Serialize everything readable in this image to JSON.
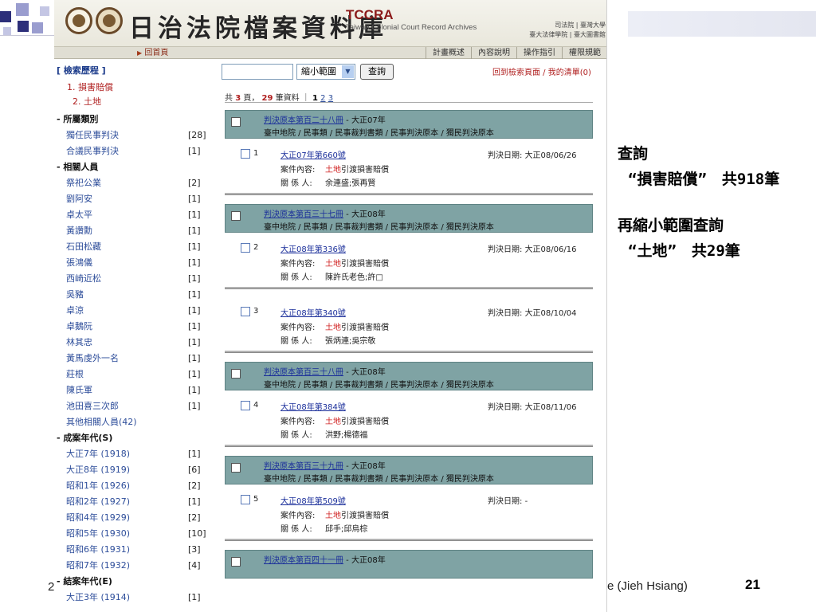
{
  "slide": {
    "annotation_lines": [
      "查詢",
      "“損害賠償”　共918筆",
      "再縮小範圍查詢",
      "“土地”　共29筆"
    ],
    "footer_left": "2",
    "footer_author": "e (Jieh Hsiang)",
    "page_number": "21",
    "colors": {
      "deco_dark": "#2d2f7a",
      "deco_light": "#9a9dcf",
      "panel": "#7fa3a4"
    }
  },
  "browser": {
    "banner": {
      "title": "日治法院檔案資料庫",
      "logo_text": "TCCRA",
      "subtitle": "Taiwan Colonial Court Record Archives",
      "sponsors_line1": "司法院 | 臺灣大學",
      "sponsors_line2": "臺大法律學院 | 臺大圖書館"
    },
    "nav": {
      "home": "回首頁",
      "tabs": [
        "計畫概述",
        "內容說明",
        "操作指引",
        "權限規範"
      ]
    },
    "sidebar": {
      "history_title": "[ 檢索歷程 ]",
      "history": [
        "1. 損害賠償",
        "2. 土地"
      ],
      "rows": [
        {
          "label": "- 所屬類別",
          "count": "",
          "cat": true
        },
        {
          "label": "獨任民事判決",
          "count": "[28]"
        },
        {
          "label": "合議民事判決",
          "count": "[1]"
        },
        {
          "label": "- 相關人員",
          "count": "",
          "cat": true
        },
        {
          "label": "祭祀公業",
          "count": "[2]"
        },
        {
          "label": "劉阿安",
          "count": "[1]"
        },
        {
          "label": "卓太平",
          "count": "[1]"
        },
        {
          "label": "黃讚勳",
          "count": "[1]"
        },
        {
          "label": "石田松藏",
          "count": "[1]"
        },
        {
          "label": "張鴻儀",
          "count": "[1]"
        },
        {
          "label": "西崎近松",
          "count": "[1]"
        },
        {
          "label": "吳豬",
          "count": "[1]"
        },
        {
          "label": "卓涼",
          "count": "[1]"
        },
        {
          "label": "卓鵝阮",
          "count": "[1]"
        },
        {
          "label": "林其忠",
          "count": "[1]"
        },
        {
          "label": "黃馬虔外一名",
          "count": "[1]"
        },
        {
          "label": "莊根",
          "count": "[1]"
        },
        {
          "label": "陳氏軍",
          "count": "[1]"
        },
        {
          "label": "池田喜三次郎",
          "count": "[1]"
        },
        {
          "label": "其他相關人員(42)",
          "count": ""
        },
        {
          "label": "- 成案年代(S)",
          "count": "",
          "cat": true
        },
        {
          "label": "大正7年 (1918)",
          "count": "[1]"
        },
        {
          "label": "大正8年 (1919)",
          "count": "[6]"
        },
        {
          "label": "昭和1年 (1926)",
          "count": "[2]"
        },
        {
          "label": "昭和2年 (1927)",
          "count": "[1]"
        },
        {
          "label": "昭和4年 (1929)",
          "count": "[2]"
        },
        {
          "label": "昭和5年 (1930)",
          "count": "[10]"
        },
        {
          "label": "昭和6年 (1931)",
          "count": "[3]"
        },
        {
          "label": "昭和7年 (1932)",
          "count": "[4]"
        },
        {
          "label": "- 結案年代(E)",
          "count": "",
          "cat": true
        },
        {
          "label": "大正3年 (1914)",
          "count": "[1]"
        }
      ]
    },
    "search": {
      "input_value": "",
      "select_value": "縮小範圍",
      "button": "查詢",
      "back_link": "回到檢索頁面",
      "list_link": "我的清單(0)"
    },
    "pager": {
      "prefix": "共",
      "pages": "3",
      "mid": "頁，",
      "total": "29",
      "suffix": "筆資料 ｜",
      "current": "1",
      "others": [
        "2",
        "3"
      ]
    },
    "case_labels": {
      "date": "判決日期:",
      "content": "案件內容:",
      "people": "關 係 人:"
    },
    "results": [
      {
        "vol_link": "判決原本第百二十八冊",
        "vol_year": " - 大正07年",
        "path": "臺中地院 / 民事類 / 民事裁判書類 / 民事判決原本 / 獨民判決原本",
        "cases": [
          {
            "num": "1",
            "title": "大正07年第660號",
            "date": "大正08/06/26",
            "kw": "土地",
            "rest": "引渡損害賠償",
            "people": "余連盛;張再賢"
          }
        ]
      },
      {
        "vol_link": "判決原本第百三十七冊",
        "vol_year": " - 大正08年",
        "path": "臺中地院 / 民事類 / 民事裁判書類 / 民事判決原本 / 獨民判決原本",
        "cases": [
          {
            "num": "2",
            "title": "大正08年第336號",
            "date": "大正08/06/16",
            "kw": "土地",
            "rest": "引渡損害賠償",
            "people": "陳許氏老色;許□"
          },
          {
            "num": "3",
            "title": "大正08年第340號",
            "date": "大正08/10/04",
            "kw": "土地",
            "rest": "引渡損害賠償",
            "people": "張炳連;吳宗敬"
          }
        ]
      },
      {
        "vol_link": "判決原本第百三十八冊",
        "vol_year": " - 大正08年",
        "path": "臺中地院 / 民事類 / 民事裁判書類 / 民事判決原本 / 獨民判決原本",
        "cases": [
          {
            "num": "4",
            "title": "大正08年第384號",
            "date": "大正08/11/06",
            "kw": "土地",
            "rest": "引渡損害賠償",
            "people": "洪野;楊德福"
          }
        ]
      },
      {
        "vol_link": "判決原本第百三十九冊",
        "vol_year": " - 大正08年",
        "path": "臺中地院 / 民事類 / 民事裁判書類 / 民事判決原本 / 獨民判決原本",
        "cases": [
          {
            "num": "5",
            "title": "大正08年第509號",
            "date": "-",
            "kw": "土地",
            "rest": "引渡損害賠償",
            "people": "邱手;邱烏棕"
          }
        ]
      },
      {
        "vol_link": "判決原本第百四十一冊",
        "vol_year": " - 大正08年",
        "path": "",
        "cases": []
      }
    ]
  }
}
